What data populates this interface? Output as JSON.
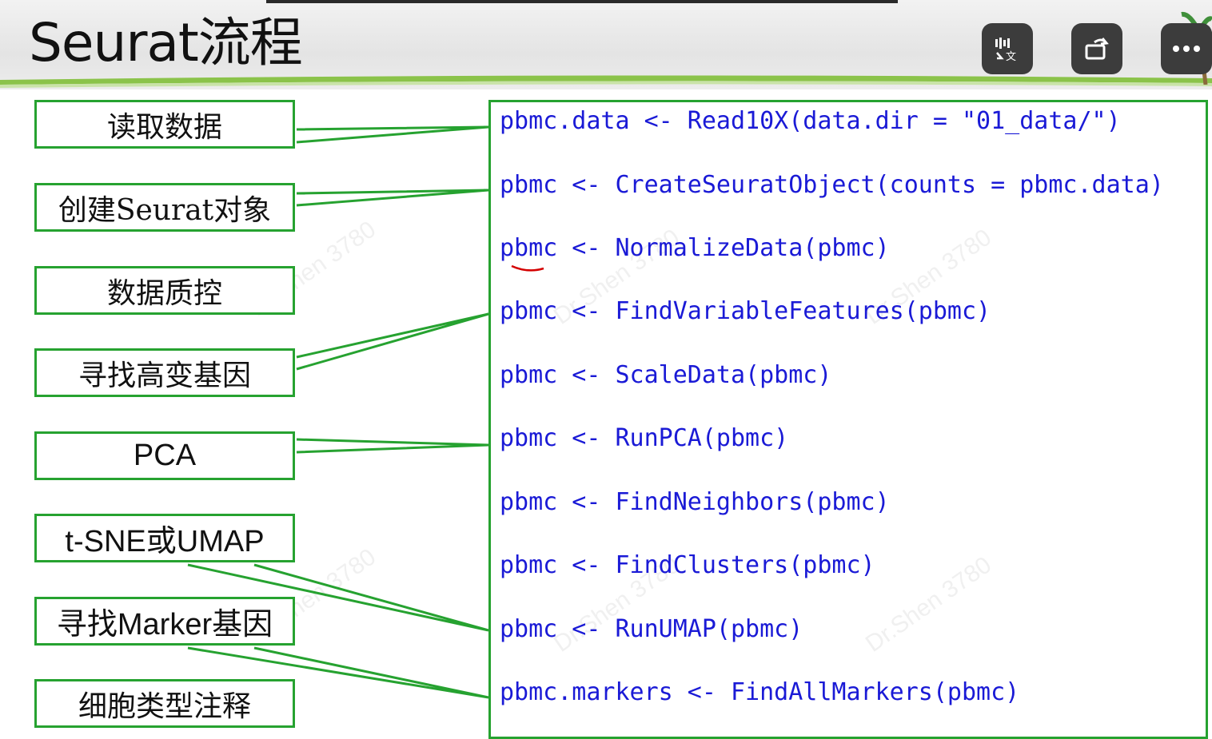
{
  "slide": {
    "title": "Seurat流程",
    "steps": [
      "读取数据",
      "创建Seurat对象",
      "数据质控",
      "寻找高变基因",
      "PCA",
      "t-SNE或UMAP",
      "寻找Marker基因",
      "细胞类型注释"
    ],
    "code": [
      "pbmc.data <- Read10X(data.dir = \"01_data/\")",
      "pbmc <- CreateSeuratObject(counts = pbmc.data)",
      "pbmc <- NormalizeData(pbmc)",
      "pbmc <- FindVariableFeatures(pbmc)",
      "pbmc <- ScaleData(pbmc)",
      "pbmc <- RunPCA(pbmc)",
      "pbmc <- FindNeighbors(pbmc)",
      "pbmc <- FindClusters(pbmc)",
      "pbmc <- RunUMAP(pbmc)",
      "pbmc.markers <- FindAllMarkers(pbmc)"
    ],
    "watermark": "Dr.Shen 3780"
  },
  "controls": {
    "icons": [
      "captions-icon",
      "rotate-icon",
      "more-icon"
    ]
  },
  "colors": {
    "box_border": "#26a230",
    "code_text": "#1a1ad6",
    "control_bg": "#3c3c3c"
  }
}
